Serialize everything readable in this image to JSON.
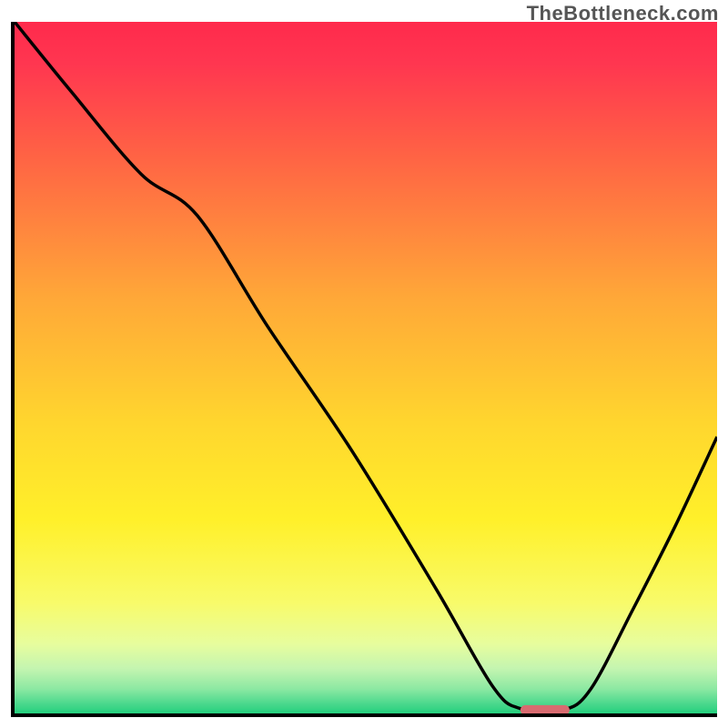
{
  "watermark": "TheBottleneck.com",
  "chart_data": {
    "type": "line",
    "title": "",
    "xlabel": "",
    "ylabel": "",
    "xlim": [
      0,
      100
    ],
    "ylim": [
      0,
      100
    ],
    "grid": false,
    "series": [
      {
        "name": "curve",
        "color": "#000000",
        "x": [
          0,
          8,
          18,
          26,
          36,
          48,
          60,
          68,
          72,
          78,
          82,
          88,
          94,
          100
        ],
        "y": [
          100,
          90,
          78,
          72,
          56,
          38,
          18,
          4,
          0.7,
          0.5,
          3.5,
          15,
          27,
          40
        ]
      }
    ],
    "marker": {
      "name": "highlight",
      "color": "#d86b70",
      "x_start": 72,
      "x_end": 79,
      "y": 0.5,
      "thickness_pct": 1.4
    },
    "background_gradient": {
      "stops": [
        {
          "offset": 0.0,
          "color": "#ff2a4c"
        },
        {
          "offset": 0.06,
          "color": "#ff3650"
        },
        {
          "offset": 0.2,
          "color": "#ff6544"
        },
        {
          "offset": 0.4,
          "color": "#ffa838"
        },
        {
          "offset": 0.58,
          "color": "#ffd62e"
        },
        {
          "offset": 0.72,
          "color": "#fff02a"
        },
        {
          "offset": 0.84,
          "color": "#f8fb6a"
        },
        {
          "offset": 0.9,
          "color": "#e7fd9e"
        },
        {
          "offset": 0.935,
          "color": "#c4f5b0"
        },
        {
          "offset": 0.965,
          "color": "#8be8a2"
        },
        {
          "offset": 0.985,
          "color": "#4dd98e"
        },
        {
          "offset": 1.0,
          "color": "#24cf7d"
        }
      ]
    }
  }
}
